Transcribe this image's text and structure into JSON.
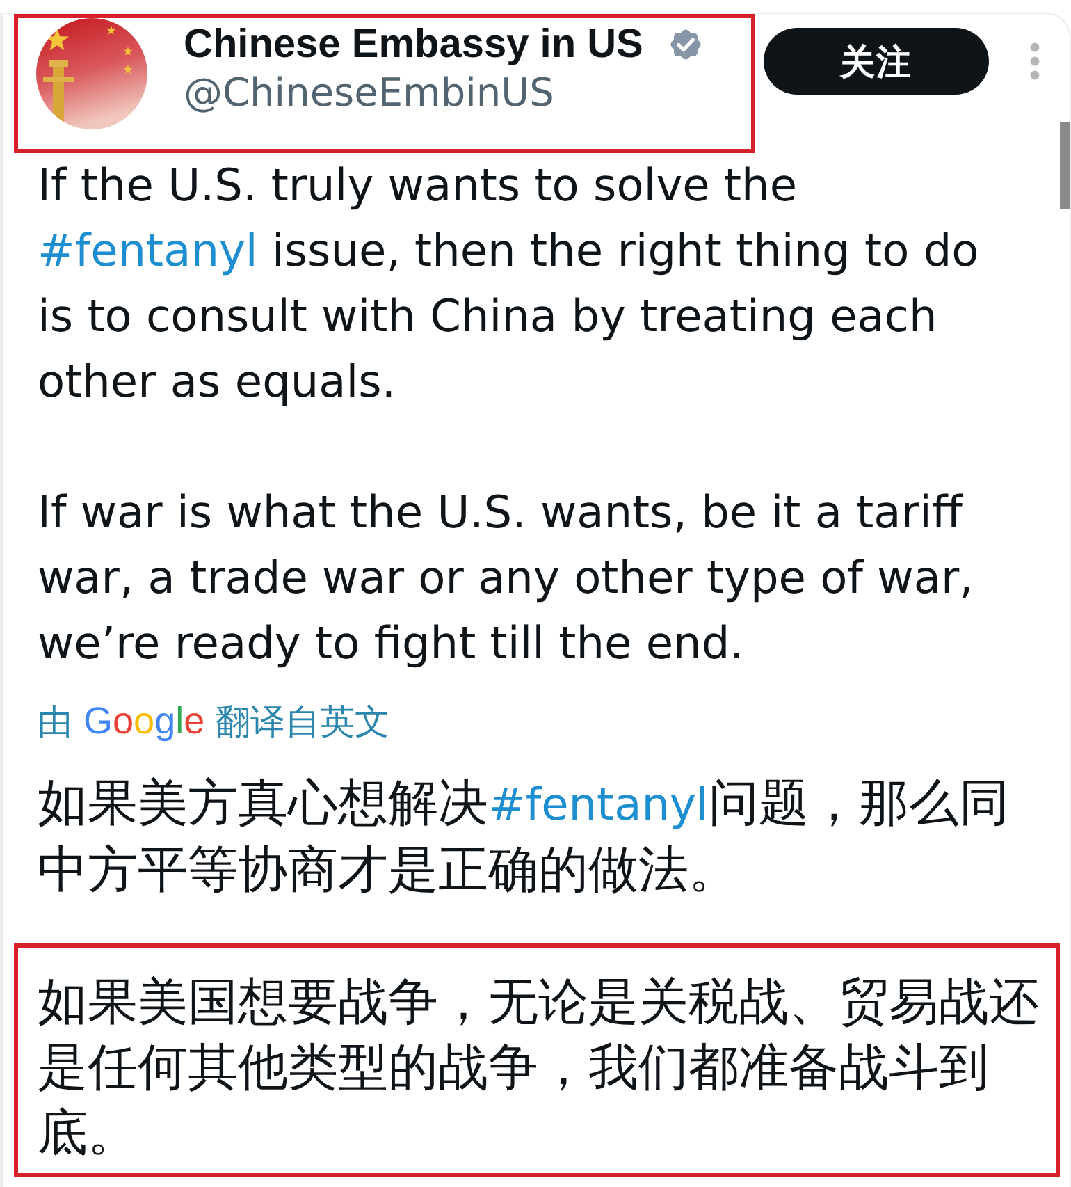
{
  "author": {
    "name": "Chinese Embassy in US",
    "handle": "@ChineseEmbinUS",
    "verified": true,
    "highlighted": true
  },
  "follow_button": {
    "label": "关注"
  },
  "paragraphs": [
    {
      "segments": [
        {
          "kind": "text",
          "text": "If the U.S. truly wants to solve the "
        },
        {
          "kind": "hashtag",
          "text": "#fentanyl"
        },
        {
          "kind": "text",
          "text": " issue, then the right thing to do is to consult with China by treating each other as equals."
        }
      ]
    },
    {
      "segments": [
        {
          "kind": "text",
          "text": "If war is what the U.S. wants, be it a tariff war, a trade war or any other type of war, we’re ready to fight till the end."
        }
      ]
    }
  ],
  "translation": {
    "prefix": "由",
    "provider": "Google",
    "suffix": "翻译自英文"
  },
  "translated_paragraphs": [
    {
      "highlighted": false,
      "segments": [
        {
          "kind": "text",
          "text": "如果美方真心想解决"
        },
        {
          "kind": "hashtag",
          "text": "#fentanyl"
        },
        {
          "kind": "text",
          "text": "问题，那么同中方平等协商才是正确的做法。"
        }
      ]
    },
    {
      "highlighted": true,
      "segments": [
        {
          "kind": "text",
          "text": "如果美国想要战争，无论是关税战、贸易战还是任何其他类型的战争，我们都准备战斗到底。"
        }
      ]
    }
  ]
}
